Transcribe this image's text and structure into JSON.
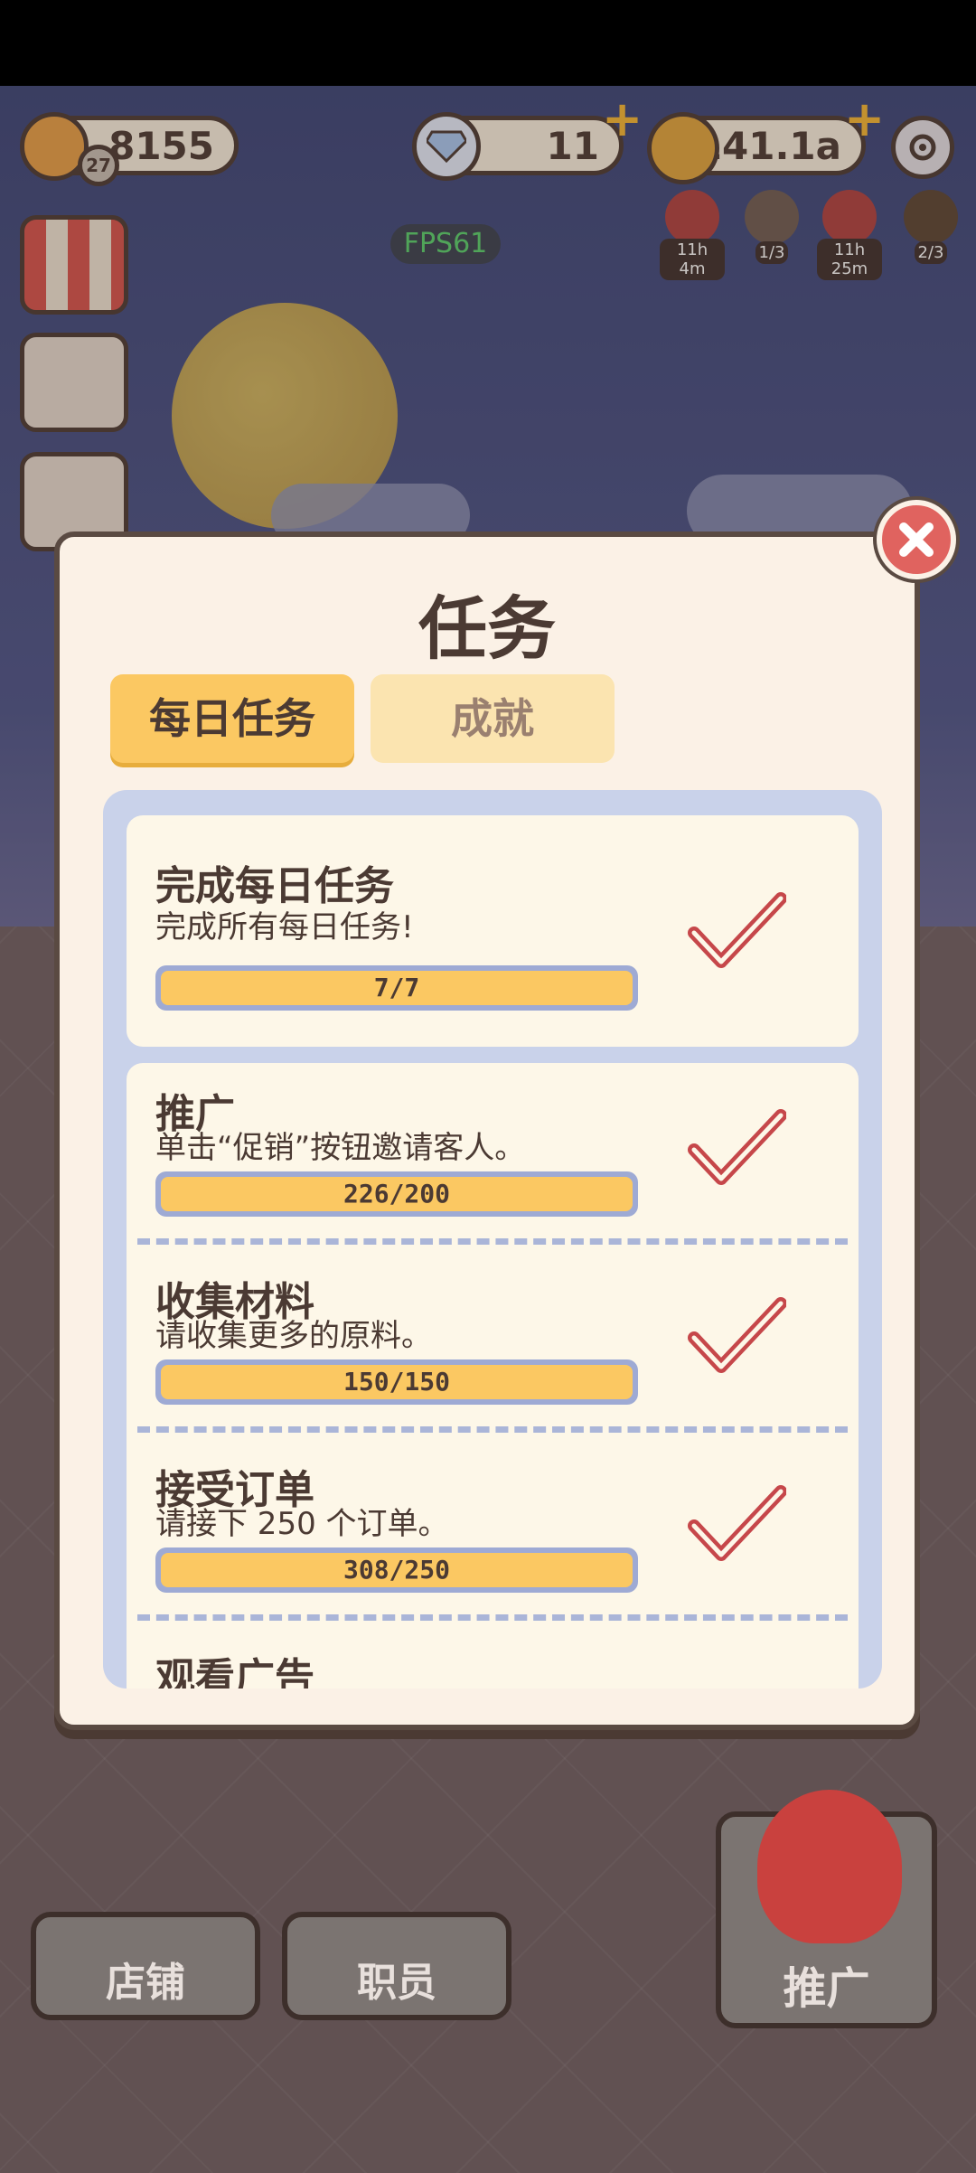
{
  "hud": {
    "level": "27",
    "bread_count": "8155",
    "diamonds": "11",
    "coins": "141.1a",
    "fps": "FPS61",
    "boosts": [
      {
        "icon": "fire-boost-icon",
        "label": "11h 4m"
      },
      {
        "icon": "cookie-boost-icon",
        "label": "1/3"
      },
      {
        "icon": "fire-boost-icon",
        "label": "11h 25m"
      },
      {
        "icon": "pastry-boost-icon",
        "label": "2/3"
      }
    ]
  },
  "dialog": {
    "title": "任务",
    "tabs": [
      {
        "label": "每日任务",
        "active": true
      },
      {
        "label": "成就",
        "active": false
      }
    ],
    "summary_task": {
      "name": "完成每日任务",
      "description": "完成所有每日任务!",
      "progress": "7/7",
      "completed": true
    },
    "tasks": [
      {
        "name": "推广",
        "description": "单击“促销”按钮邀请客人。",
        "progress": "226/200",
        "completed": true
      },
      {
        "name": "收集材料",
        "description": "请收集更多的原料。",
        "progress": "150/150",
        "completed": true
      },
      {
        "name": "接受订单",
        "description": "请接下 250 个订单。",
        "progress": "308/250",
        "completed": true
      },
      {
        "name": "观看广告",
        "description": "",
        "progress": "",
        "completed": false
      }
    ]
  },
  "bottom_nav": {
    "shop": "店铺",
    "staff": "职员",
    "promote": "推广"
  },
  "colors": {
    "accent_yellow": "#fbc862",
    "panel_bg": "#fbf1e6",
    "check_red": "#c6474a",
    "close_red": "#e0635f"
  }
}
